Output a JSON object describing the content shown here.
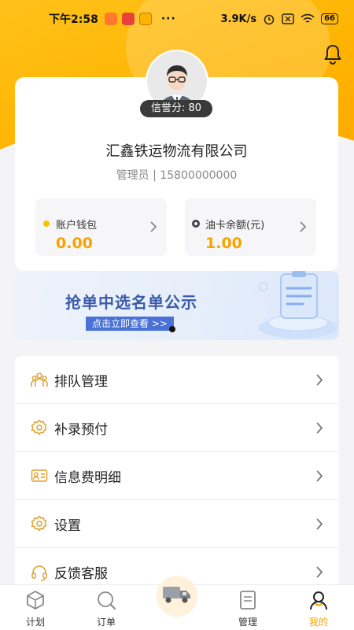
{
  "status_bar": {
    "time": "下午2:58",
    "dots": "···",
    "net_speed": "3.9K/s",
    "battery": "66"
  },
  "profile": {
    "credit_label": "信誉分: 80",
    "company": "汇鑫铁运物流有限公司",
    "role": "管理员 | 15800000000"
  },
  "wallets": [
    {
      "label": "账户钱包",
      "amount": "0.00",
      "dot_color": "#f5c400"
    },
    {
      "label": "油卡余额(元)",
      "amount": "1.00",
      "dot_color": "#444444"
    }
  ],
  "banner": {
    "title": "抢单中选名单公示",
    "cta": "点击立即查看 >>"
  },
  "menu": [
    {
      "label": "排队管理",
      "icon": "queue-people-icon"
    },
    {
      "label": "补录预付",
      "icon": "gear-icon"
    },
    {
      "label": "信息费明细",
      "icon": "id-card-icon"
    },
    {
      "label": "设置",
      "icon": "settings-icon"
    },
    {
      "label": "反馈客服",
      "icon": "headset-icon"
    }
  ],
  "tabs": [
    {
      "label": "计划",
      "icon": "box-icon",
      "active": false
    },
    {
      "label": "订单",
      "icon": "search-icon",
      "active": false
    },
    {
      "label": "",
      "icon": "truck-icon",
      "active": false
    },
    {
      "label": "管理",
      "icon": "document-icon",
      "active": false
    },
    {
      "label": "我的",
      "icon": "user-icon",
      "active": true
    }
  ],
  "colors": {
    "accent": "#f5a400",
    "header": "#ffb300",
    "banner_text": "#3a5aa8"
  }
}
